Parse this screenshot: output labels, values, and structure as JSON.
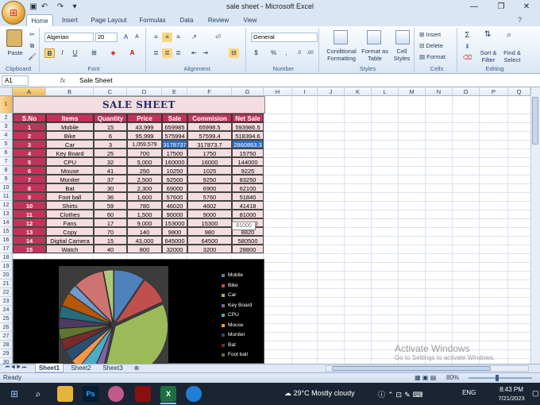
{
  "window": {
    "title": "sale sheet - Microsoft Excel"
  },
  "tabs": [
    "Home",
    "Insert",
    "Page Layout",
    "Formulas",
    "Data",
    "Review",
    "View"
  ],
  "ribbon": {
    "clipboard": {
      "label": "Clipboard",
      "paste": "Paste"
    },
    "font": {
      "label": "Font",
      "name": "Algerian",
      "size": "20"
    },
    "alignment": {
      "label": "Alignment"
    },
    "number": {
      "label": "Number",
      "format": "General"
    },
    "styles": {
      "label": "Styles",
      "conditional": "Conditional Formatting",
      "table": "Format as Table",
      "cell": "Cell Styles"
    },
    "cells": {
      "label": "Cells",
      "insert": "Insert",
      "delete": "Delete",
      "format": "Format"
    },
    "editing": {
      "label": "Editing",
      "sort": "Sort & Filter",
      "find": "Find & Select"
    }
  },
  "formula": {
    "namebox": "A1",
    "fx": "fx",
    "content": "Sale Sheet"
  },
  "columns": [
    "A",
    "B",
    "C",
    "D",
    "E",
    "F",
    "G",
    "H",
    "I",
    "J",
    "K",
    "L",
    "M",
    "N",
    "O",
    "P",
    "Q"
  ],
  "rows": [
    "1",
    "2",
    "3",
    "4",
    "5",
    "6",
    "7",
    "8",
    "9",
    "10",
    "11",
    "12",
    "13",
    "14",
    "15",
    "16",
    "17",
    "18",
    "19",
    "20",
    "21",
    "22",
    "23",
    "24",
    "25",
    "26",
    "27",
    "28",
    "29",
    "30"
  ],
  "sheet": {
    "title": "SALE SHEET",
    "headers": [
      "S.No",
      "Items",
      "Quantity",
      "Price",
      "Sale",
      "Commision",
      "Net Sale"
    ],
    "data": [
      [
        "1",
        "Mobile",
        "15",
        "43,999",
        "659985",
        "65998.5",
        "593986.5"
      ],
      [
        "2",
        "Bike",
        "6",
        "95,999",
        "575994",
        "57599.4",
        "518394.6"
      ],
      [
        "3",
        "Car",
        "3",
        "1,059,579",
        "3178737",
        "317873.7",
        "2860863.3"
      ],
      [
        "4",
        "Key Board",
        "25",
        "700",
        "17500",
        "1750",
        "15750"
      ],
      [
        "5",
        "CPU",
        "32",
        "5,000",
        "160000",
        "16000",
        "144000"
      ],
      [
        "6",
        "Mouse",
        "41",
        "250",
        "10250",
        "1025",
        "9225"
      ],
      [
        "7",
        "Moniter",
        "37",
        "2,500",
        "92500",
        "9250",
        "83250"
      ],
      [
        "8",
        "Bat",
        "30",
        "2,300",
        "69000",
        "6900",
        "62100"
      ],
      [
        "9",
        "Foot ball",
        "36",
        "1,600",
        "57600",
        "5760",
        "51840"
      ],
      [
        "10",
        "Shirts",
        "59",
        "780",
        "46020",
        "4602",
        "41418"
      ],
      [
        "11",
        "Clothes",
        "60",
        "1,500",
        "90000",
        "9000",
        "81000"
      ],
      [
        "12",
        "Fans",
        "17",
        "9,000",
        "153000",
        "15300",
        "137700"
      ],
      [
        "13",
        "Copy",
        "70",
        "140",
        "9800",
        "980",
        "8820"
      ],
      [
        "14",
        "Digital Camera",
        "15",
        "43,000",
        "645000",
        "64500",
        "580500"
      ],
      [
        "15",
        "Watch",
        "40",
        "800",
        "32000",
        "3200",
        "28800"
      ]
    ]
  },
  "tooltip": "81000",
  "chart_data": {
    "type": "pie",
    "categories": [
      "Mobile",
      "Bike",
      "Car",
      "Key Board",
      "CPU",
      "Mouse",
      "Moniter",
      "Bat",
      "Foot ball",
      "Shirts",
      "Clothes",
      "Fans",
      "Copy",
      "Digital Camera",
      "Watch"
    ],
    "values": [
      593986.5,
      518394.6,
      2860863.3,
      15750,
      144000,
      9225,
      83250,
      62100,
      51840,
      41418,
      81000,
      137700,
      8820,
      580500,
      28800
    ],
    "colors": [
      "#4f81bd",
      "#c0504d",
      "#9bbb59",
      "#8064a2",
      "#4bacc6",
      "#f79646",
      "#2c4d75",
      "#772c2a",
      "#5f7530",
      "#4d3b62",
      "#276a7c",
      "#b65708",
      "#729aca",
      "#cd7371",
      "#afc97a"
    ],
    "legend_visible": [
      "Mobile",
      "Bike",
      "Car",
      "Key Board",
      "CPU",
      "Mouse",
      "Moniter",
      "Bat",
      "Foot ball"
    ]
  },
  "sheet_tabs": [
    "Sheet1",
    "Sheet2",
    "Sheet3"
  ],
  "status": {
    "text": "Ready",
    "zoom": "80%"
  },
  "watermark": {
    "line1": "Activate Windows",
    "line2": "Go to Settings to activate Windows."
  },
  "taskbar": {
    "weather": "29°C  Mostly cloudy",
    "lang": "ENG",
    "time": "8:43 PM",
    "date": "7/21/2023"
  }
}
